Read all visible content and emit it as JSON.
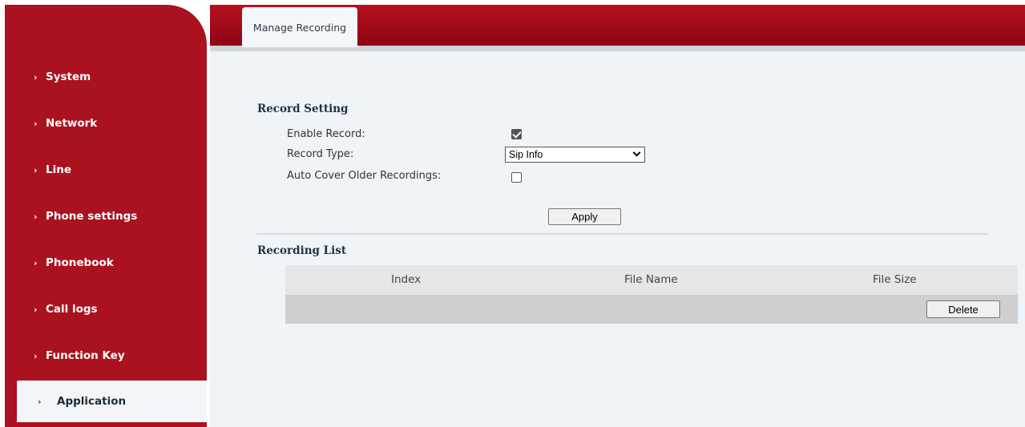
{
  "sidebar": {
    "items": [
      {
        "label": "System"
      },
      {
        "label": "Network"
      },
      {
        "label": "Line"
      },
      {
        "label": "Phone settings"
      },
      {
        "label": "Phonebook"
      },
      {
        "label": "Call logs"
      },
      {
        "label": "Function Key"
      },
      {
        "label": "Application"
      }
    ],
    "active": "Application"
  },
  "tabs": [
    {
      "label": "Manage Recording"
    }
  ],
  "record_setting": {
    "title": "Record Setting",
    "enable_record_label": "Enable Record:",
    "enable_record_checked": true,
    "record_type_label": "Record Type:",
    "record_type_value": "Sip Info",
    "auto_cover_label": "Auto Cover Older Recordings:",
    "auto_cover_checked": false,
    "apply_label": "Apply"
  },
  "recording_list": {
    "title": "Recording List",
    "columns": [
      "Index",
      "File Name",
      "File Size"
    ],
    "rows": [],
    "delete_label": "Delete"
  },
  "colors": {
    "brand_red": "#ab1220",
    "content_bg": "#eef4f7"
  }
}
